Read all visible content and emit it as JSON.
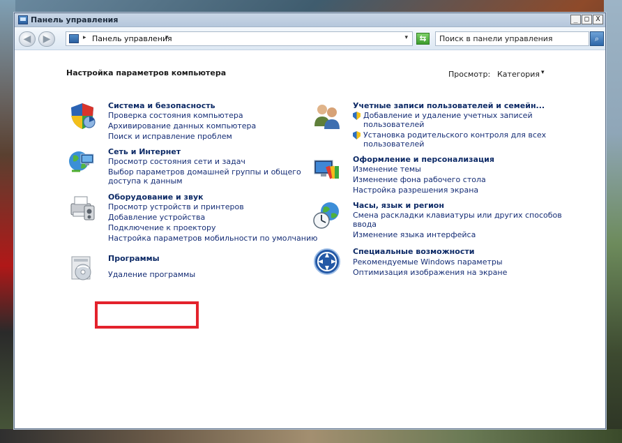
{
  "window": {
    "title": "Панель управления"
  },
  "controls": {
    "minimize": "_",
    "maximize": "□",
    "close": "X"
  },
  "toolbar": {
    "back_glyph": "◀",
    "forward_glyph": "▶",
    "breadcrumb": "Панель управления",
    "search_placeholder": "Поиск в панели управления",
    "refresh_glyph": "⇆",
    "search_glyph": "⌕",
    "separator_glyph": "▸",
    "dropdown_glyph": "▾"
  },
  "header": {
    "title": "Настройка параметров компьютера",
    "view_label": "Просмотр:",
    "view_value": "Категория",
    "view_arrow": "▾"
  },
  "left": [
    {
      "title": "Система и безопасность",
      "links": [
        "Проверка состояния компьютера",
        "Архивирование данных компьютера",
        "Поиск и исправление проблем"
      ]
    },
    {
      "title": "Сеть и Интернет",
      "links": [
        "Просмотр состояния сети и задач",
        "Выбор параметров домашней группы и общего",
        "доступа к данным"
      ]
    },
    {
      "title": "Оборудование и звук",
      "links": [
        "Просмотр устройств и принтеров",
        "Добавление устройства",
        "Подключение к проектору",
        "Настройка параметров мобильности по умолчанию"
      ]
    },
    {
      "title": "Программы",
      "links": [
        "Удаление программы"
      ]
    }
  ],
  "right": [
    {
      "title": "Учетные записи пользователей и семейн...",
      "links": [
        "Добавление и удаление учетных записей",
        "пользователей",
        "Установка родительского контроля для всех",
        "пользователей"
      ]
    },
    {
      "title": "Оформление и персонализация",
      "links": [
        "Изменение темы",
        "Изменение фона рабочего стола",
        "Настройка разрешения экрана"
      ]
    },
    {
      "title": "Часы, язык и регион",
      "links": [
        "Смена раскладки клавиатуры или других способов",
        "ввода",
        "Изменение языка интерфейса"
      ]
    },
    {
      "title": "Специальные возможности",
      "links": [
        "Рекомендуемые Windows параметры",
        "Оптимизация изображения на экране"
      ]
    }
  ],
  "icons": {
    "system": "shield-icon",
    "network": "network-globe-icon",
    "hardware": "printer-icon",
    "programs": "programs-disc-icon",
    "accounts": "users-icon",
    "appearance": "monitor-palette-icon",
    "clock": "clock-globe-icon",
    "access": "ease-of-access-icon"
  },
  "colors": {
    "link": "#152d75",
    "title": "#0d2a66",
    "highlight": "#e3222c"
  }
}
